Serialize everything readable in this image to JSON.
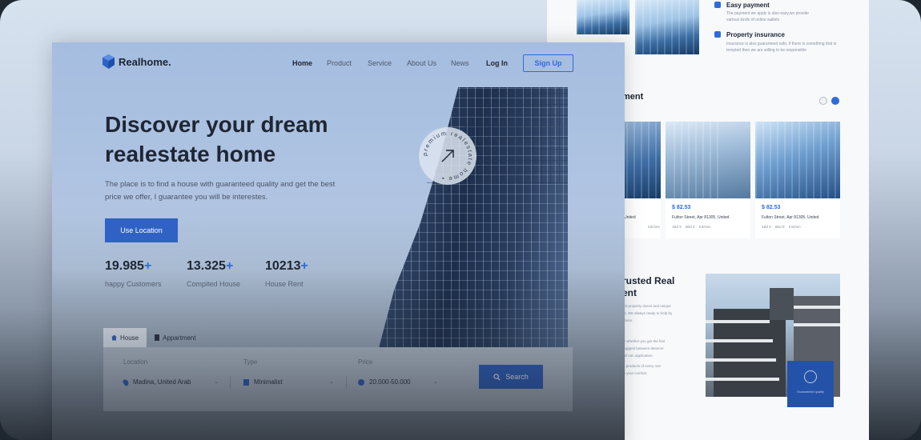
{
  "back_page": {
    "features": [
      {
        "title": "Easy payment",
        "desc_line1": "The payment we apply is also easy,we provide",
        "desc_line2": "various kinds of online wallets"
      },
      {
        "title": "Property insurance",
        "desc_line1": "Insurance is also guaranteed safe, if there is something that is",
        "desc_line2": "tempted then we are willing to be responsible"
      }
    ],
    "apartment_heading": "ment",
    "cards": [
      {
        "price": "",
        "address": "r, United",
        "meta": "Kitchen"
      },
      {
        "price": "$ 82.53",
        "address": "Fulton Street, Apr 81305, United",
        "meta_bed": "1Bd 9",
        "meta_bath": "5Bd 9",
        "meta_kitchen": "Kitchen"
      },
      {
        "price": "$ 82.53",
        "address": "Fulton Street, Apr 81305, United",
        "meta_bed": "1Bd 9",
        "meta_bath": "5Bd 9",
        "meta_kitchen": "Kitchen"
      }
    ],
    "trusted_heading_line1": "rusted Real",
    "trusted_heading_line2": "ent",
    "trusted_lines": [
      "ent property dozes and unique",
      "us. We always ready to help by",
      "ervice.",
      "er whether you get the fest",
      "ouggest between deserve",
      "uld not. application",
      "st products of every one",
      "re your comfort."
    ],
    "badge_text": "Guaranteed quality"
  },
  "front_page": {
    "brand": "Realhome.",
    "nav": [
      {
        "label": "Home",
        "active": true
      },
      {
        "label": "Product",
        "active": false
      },
      {
        "label": "Service",
        "active": false
      },
      {
        "label": "About Us",
        "active": false
      },
      {
        "label": "News",
        "active": false
      }
    ],
    "login": "Log In",
    "signup": "Sign Up",
    "hero": {
      "title_line1": "Discover your dream",
      "title_line2": "realestate home",
      "subtitle_line1": "The place is to find a house with guaranteed quality and get the best",
      "subtitle_line2": "price we offer, I guarantee you will be interestes.",
      "cta": "Use Location"
    },
    "stats": [
      {
        "value": "19.985",
        "suffix": "+",
        "label": "happy Customers"
      },
      {
        "value": "13.325",
        "suffix": "+",
        "label": "Compited House"
      },
      {
        "value": "10213",
        "suffix": "+",
        "label": "House Rent"
      }
    ],
    "seal_text": "premium realestate home •",
    "search": {
      "tabs": [
        {
          "label": "House",
          "active": true
        },
        {
          "label": "Appartment",
          "active": false
        }
      ],
      "location_label": "Location",
      "location_value": "Madina, United Arab",
      "type_label": "Type",
      "type_value": "Minimalist",
      "price_label": "Price",
      "price_value": "20.000-50.000",
      "button": "Search"
    }
  },
  "colors": {
    "accent": "#2f62c4",
    "dark_text": "#1f2633"
  },
  "icons": [
    "cube-logo-icon",
    "location-pin-icon",
    "building-icon",
    "dollar-icon",
    "search-icon",
    "chevron-down-icon",
    "arrow-up-right-icon",
    "house-icon",
    "apartment-icon",
    "shield-icon"
  ]
}
